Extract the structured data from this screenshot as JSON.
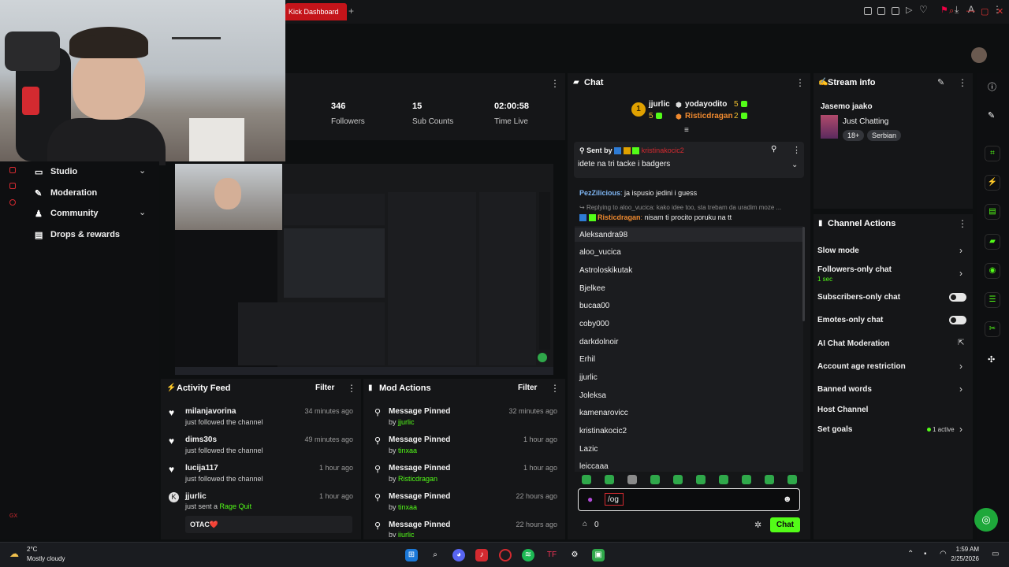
{
  "browser": {
    "tab_title": "Kick Dashboard",
    "new_tab": "+"
  },
  "stats": [
    {
      "value": "346",
      "label": "Followers"
    },
    {
      "value": "15",
      "label": "Sub Counts"
    },
    {
      "value": "02:00:58",
      "label": "Time Live"
    }
  ],
  "sidebar": {
    "items": [
      {
        "label": "Studio",
        "icon": "studio-icon",
        "expand": true
      },
      {
        "label": "Moderation",
        "icon": "shield-icon",
        "expand": false
      },
      {
        "label": "Community",
        "icon": "people-icon",
        "expand": true
      },
      {
        "label": "Drops & rewards",
        "icon": "gift-icon",
        "expand": false
      }
    ]
  },
  "activity_feed": {
    "title": "Activity Feed",
    "filter": "Filter",
    "items": [
      {
        "name": "milanjavorina",
        "sub": "just followed the channel",
        "time": "34 minutes ago"
      },
      {
        "name": "dims30s",
        "sub": "just followed the channel",
        "time": "49 minutes ago"
      },
      {
        "name": "lucija117",
        "sub": "just followed the channel",
        "time": "1 hour ago"
      },
      {
        "name": "jjurlic",
        "sub": "just sent a",
        "sub_highlight": "Rage Quit",
        "time": "1 hour ago",
        "message": "OTAC❤️"
      }
    ]
  },
  "mod_actions": {
    "title": "Mod Actions",
    "filter": "Filter",
    "items": [
      {
        "action": "Message Pinned",
        "by": "by",
        "mod": "jjurlic",
        "time": "32 minutes ago"
      },
      {
        "action": "Message Pinned",
        "by": "by",
        "mod": "tinxaa",
        "time": "1 hour ago"
      },
      {
        "action": "Message Pinned",
        "by": "by",
        "mod": "Risticdragan",
        "time": "1 hour ago"
      },
      {
        "action": "Message Pinned",
        "by": "by",
        "mod": "tinxaa",
        "time": "22 hours ago"
      },
      {
        "action": "Message Pinned",
        "by": "by",
        "mod": "jjurlic",
        "time": "22 hours ago"
      }
    ]
  },
  "chat": {
    "title": "Chat",
    "leaderboard": [
      {
        "name": "jjurlic",
        "count": "5"
      },
      {
        "name": "yodayodito",
        "count": "5"
      },
      {
        "name": "Risticdragan",
        "count": "2"
      }
    ],
    "rank_badge": "1",
    "pinned": {
      "sent_by_label": "Sent by",
      "sender": "kristinakocic2",
      "text": "idete na tri tacke i badgers"
    },
    "messages": [
      {
        "user": "PezZilicious",
        "text": "ja ispusio jedini i guess"
      },
      {
        "reply_to": "Replying to aloo_vucica: kako idee too, sta trebam da uradim moze ...",
        "user": "Risticdragan",
        "text": "nisam ti procito poruku na tt"
      }
    ],
    "mention_list": [
      "Aleksandra98",
      "aloo_vucica",
      "Astroloskikutak",
      "Bjelkee",
      "bucaa00",
      "coby000",
      "darkdolnoir",
      "Erhil",
      "jjurlic",
      "Joleksa",
      "kamenarovicc",
      "kristinakocic2",
      "Lazic",
      "leiccaaa"
    ],
    "input_value": "/og",
    "points": "0",
    "send_label": "Chat"
  },
  "stream_info": {
    "title": "Stream info",
    "stream_title": "Jasemo jaako",
    "category": "Just Chatting",
    "tags": [
      "18+",
      "Serbian"
    ]
  },
  "channel_actions": {
    "title": "Channel Actions",
    "items": [
      {
        "label": "Slow mode",
        "control": "chevron"
      },
      {
        "label": "Followers-only chat",
        "sub": "1 sec",
        "control": "chevron"
      },
      {
        "label": "Subscribers-only chat",
        "control": "toggle"
      },
      {
        "label": "Emotes-only chat",
        "control": "toggle"
      },
      {
        "label": "AI Chat Moderation",
        "control": "external"
      },
      {
        "label": "Account age restriction",
        "control": "chevron"
      },
      {
        "label": "Banned words",
        "control": "chevron"
      },
      {
        "label": "Host Channel",
        "control": "none"
      },
      {
        "label": "Set goals",
        "badge": "1 active",
        "control": "chevron"
      }
    ]
  },
  "taskbar": {
    "weather_temp": "2°C",
    "weather_desc": "Mostly cloudy",
    "time": "1:59 AM",
    "date": "2/25/2026"
  },
  "colors": {
    "accent": "#53fc18",
    "danger": "#d42a30",
    "panel": "#151618"
  }
}
